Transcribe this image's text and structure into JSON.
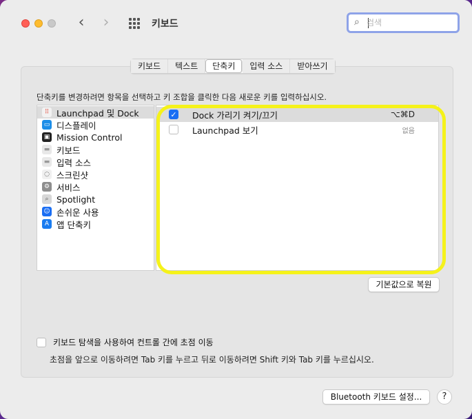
{
  "window": {
    "title": "키보드"
  },
  "search": {
    "placeholder": "검색",
    "value": ""
  },
  "tabs": [
    {
      "label": "키보드",
      "active": false
    },
    {
      "label": "텍스트",
      "active": false
    },
    {
      "label": "단축키",
      "active": true
    },
    {
      "label": "입력 소스",
      "active": false
    },
    {
      "label": "받아쓰기",
      "active": false
    }
  ],
  "description": "단축키를 변경하려면 항목을 선택하고 키 조합을 클릭한 다음 새로운 키를 입력하십시오.",
  "sidebar": {
    "items": [
      {
        "label": "Launchpad 및 Dock",
        "icon": "launchpad-icon",
        "selected": true
      },
      {
        "label": "디스플레이",
        "icon": "display-icon",
        "selected": false
      },
      {
        "label": "Mission Control",
        "icon": "mission-control-icon",
        "selected": false
      },
      {
        "label": "키보드",
        "icon": "keyboard-icon",
        "selected": false
      },
      {
        "label": "입력 소스",
        "icon": "input-source-icon",
        "selected": false
      },
      {
        "label": "스크린샷",
        "icon": "screenshot-icon",
        "selected": false
      },
      {
        "label": "서비스",
        "icon": "services-gear-icon",
        "selected": false
      },
      {
        "label": "Spotlight",
        "icon": "spotlight-icon",
        "selected": false
      },
      {
        "label": "손쉬운 사용",
        "icon": "accessibility-icon",
        "selected": false
      },
      {
        "label": "앱 단축키",
        "icon": "app-shortcuts-icon",
        "selected": false
      }
    ]
  },
  "shortcuts": [
    {
      "label": "Dock 가리기 켜기/끄기",
      "checked": true,
      "key": "⌥⌘D",
      "selected": true
    },
    {
      "label": "Launchpad 보기",
      "checked": false,
      "key": "없음",
      "selected": false
    }
  ],
  "buttons": {
    "restore_defaults": "기본값으로 복원",
    "bluetooth_setup": "Bluetooth 키보드 설정...",
    "help": "?"
  },
  "keyboard_navigation": {
    "label": "키보드 탐색을 사용하여 컨트롤 간에 초점 이동",
    "checked": false,
    "help_text": "초점을 앞으로 이동하려면 Tab 키를 누르고 뒤로 이동하려면 Shift 키와 Tab 키를 누르십시오."
  },
  "colors": {
    "highlight": "#f5f21a",
    "accent": "#1a6ef3"
  }
}
